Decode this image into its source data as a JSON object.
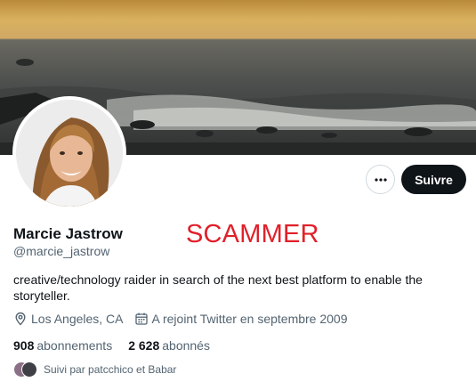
{
  "profile": {
    "display_name": "Marcie Jastrow",
    "handle": "@marcie_jastrow",
    "bio": "creative/technology raider in search of the next best platform to enable the storyteller.",
    "location": "Los Angeles, CA",
    "joined": "A rejoint Twitter en septembre 2009",
    "following_count": "908",
    "following_label": "abonnements",
    "followers_count": "2 628",
    "followers_label": "abonnés",
    "followed_by": "Suivi par patcchico et Babar"
  },
  "actions": {
    "more_icon": "more-horizontal-icon",
    "follow_label": "Suivre"
  },
  "annotation": {
    "text": "SCAMMER",
    "color": "#e0202a"
  },
  "colors": {
    "primary_text": "#0f1419",
    "secondary_text": "#536471",
    "follow_button_bg": "#0f1419"
  },
  "icons": {
    "location": "map-pin-icon",
    "joined": "calendar-icon"
  }
}
